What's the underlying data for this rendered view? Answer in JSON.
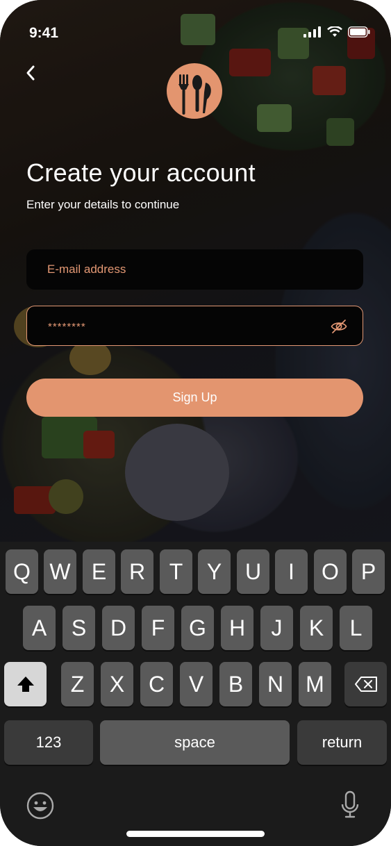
{
  "status_bar": {
    "time": "9:41"
  },
  "header": {
    "title": "Create your account",
    "subtitle": "Enter your details to continue"
  },
  "form": {
    "email_placeholder": "E-mail address",
    "password_value": "********",
    "submit_label": "Sign Up"
  },
  "keyboard": {
    "row1": [
      "Q",
      "W",
      "E",
      "R",
      "T",
      "Y",
      "U",
      "I",
      "O",
      "P"
    ],
    "row2": [
      "A",
      "S",
      "D",
      "F",
      "G",
      "H",
      "J",
      "K",
      "L"
    ],
    "row3": [
      "Z",
      "X",
      "C",
      "V",
      "B",
      "N",
      "M"
    ],
    "numbers_label": "123",
    "space_label": "space",
    "return_label": "return"
  },
  "colors": {
    "accent": "#e3956f",
    "keyboard_bg": "#1b1b1b",
    "key": "#5a5a5a"
  },
  "icons": [
    "back-icon",
    "logo-icon",
    "eye-off-icon",
    "shift-icon",
    "backspace-icon",
    "emoji-icon",
    "mic-icon",
    "signal-icon",
    "wifi-icon",
    "battery-icon"
  ]
}
